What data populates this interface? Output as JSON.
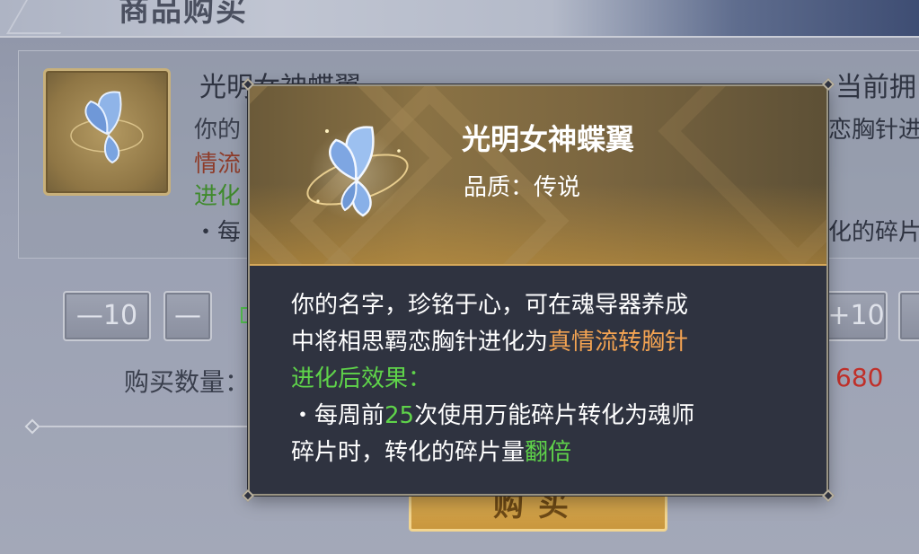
{
  "dialog": {
    "title": "商品购买",
    "item_name": "光明女神蝶翼",
    "desc_line1": "你的",
    "desc_line2": "情流",
    "desc_line3": "进化",
    "desc_line4": "・每",
    "owned_label": "当前拥",
    "right_text1": "恋胸针进",
    "right_text2": "化的碎片",
    "qty_buttons": {
      "minus10": "—10",
      "minus1": "—",
      "plus10": "+10",
      "plus1": ""
    },
    "qty_label": "购买数量：",
    "price": "680",
    "buy_button": "购买"
  },
  "tooltip": {
    "title": "光明女神蝶翼",
    "quality_label": "品质：",
    "quality_value": "传说",
    "line1": "你的名字，珍铭于心，可在魂导器养成",
    "line2_a": "中将相思羁恋胸针进化为",
    "line2_b": "真情流转胸针",
    "line3": "进化后效果：",
    "line4_a": "・每周前",
    "line4_b": "25",
    "line4_c": "次使用万能碎片转化为魂师",
    "line5_a": "碎片时，转化的碎片量",
    "line5_b": "翻倍"
  },
  "colors": {
    "accent_orange": "#f3a352",
    "accent_green": "#5fd34a",
    "price_red": "#c0302a"
  },
  "icons": [
    "butterfly-wing-icon"
  ]
}
